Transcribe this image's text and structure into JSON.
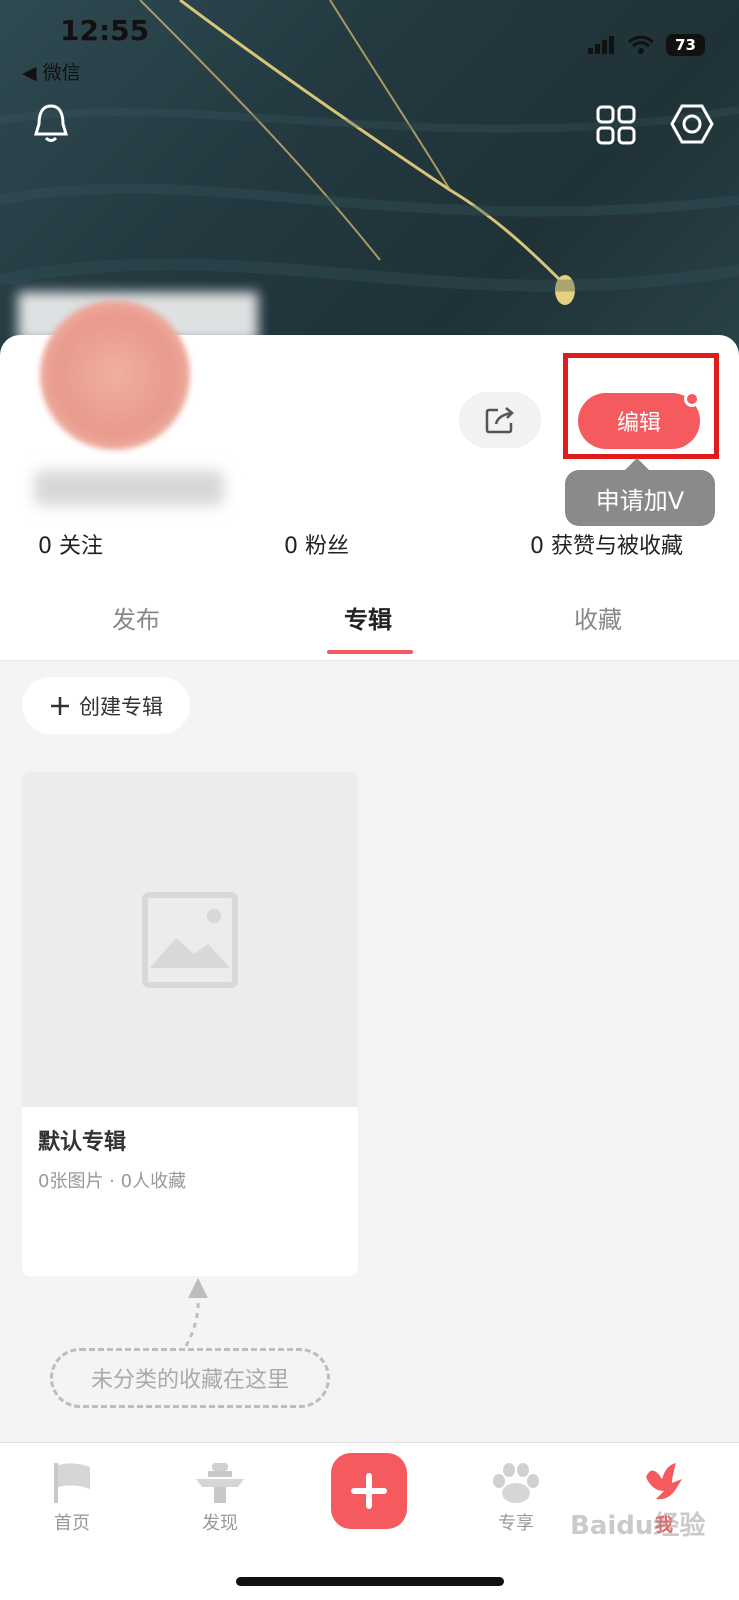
{
  "status_bar": {
    "time": "12:55",
    "back_app": "◀ 微信",
    "battery": "73"
  },
  "header": {
    "icons": [
      "bell-icon",
      "grid-icon",
      "settings-icon"
    ]
  },
  "profile": {
    "share_icon": "share-icon",
    "edit_label": "编辑",
    "tooltip": "申请加V",
    "stats": [
      {
        "label": "0 关注"
      },
      {
        "label": "0 粉丝"
      },
      {
        "label": "0 获赞与被收藏"
      }
    ]
  },
  "tabs": [
    {
      "label": "发布",
      "active": false
    },
    {
      "label": "专辑",
      "active": true
    },
    {
      "label": "收藏",
      "active": false
    }
  ],
  "albums": {
    "create_label": "创建专辑",
    "items": [
      {
        "title": "默认专辑",
        "meta": "0张图片 · 0人收藏"
      }
    ],
    "hint": "未分类的收藏在这里"
  },
  "bottom_nav": [
    {
      "label": "首页",
      "icon": "flag-icon",
      "active": false
    },
    {
      "label": "发现",
      "icon": "explore-icon",
      "active": false
    },
    {
      "label": "",
      "icon": "plus-icon",
      "active": false
    },
    {
      "label": "专享",
      "icon": "paw-icon",
      "active": false
    },
    {
      "label": "我",
      "icon": "bird-icon",
      "active": true
    }
  ],
  "colors": {
    "accent": "#f45a5e",
    "highlight": "#e01b1b"
  },
  "watermark": "Baidu经验"
}
